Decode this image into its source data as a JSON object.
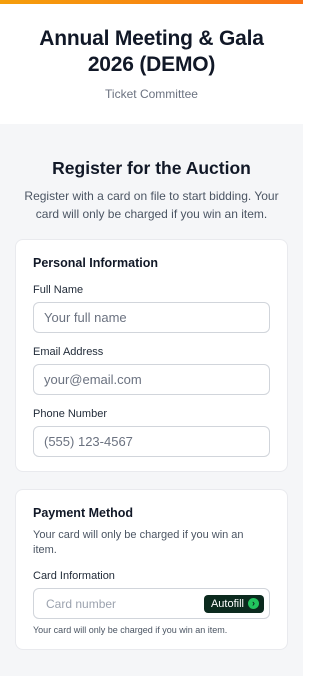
{
  "event": {
    "title": "Annual Meeting & Gala 2026 (DEMO)",
    "organizer": "Ticket Committee"
  },
  "register": {
    "title": "Register for the Auction",
    "subtitle": "Register with a card on file to start bidding. Your card will only be charged if you win an item."
  },
  "personal": {
    "title": "Personal Information",
    "full_name_label": "Full Name",
    "full_name_placeholder": "Your full name",
    "email_label": "Email Address",
    "email_placeholder": "your@email.com",
    "phone_label": "Phone Number",
    "phone_placeholder": "(555) 123-4567"
  },
  "payment": {
    "title": "Payment Method",
    "subtitle": "Your card will only be charged if you win an item.",
    "card_label": "Card Information",
    "card_placeholder": "Card number",
    "autofill_label": "Autofill",
    "note": "Your card will only be charged if you win an item."
  },
  "colors": {
    "accent_bar_start": "#f59e0b",
    "accent_bar_end": "#f97316",
    "autofill_bg": "#0b2a1e",
    "autofill_icon": "#22c55e"
  },
  "icons": {
    "autofill": "chevron-right-circle-icon"
  }
}
